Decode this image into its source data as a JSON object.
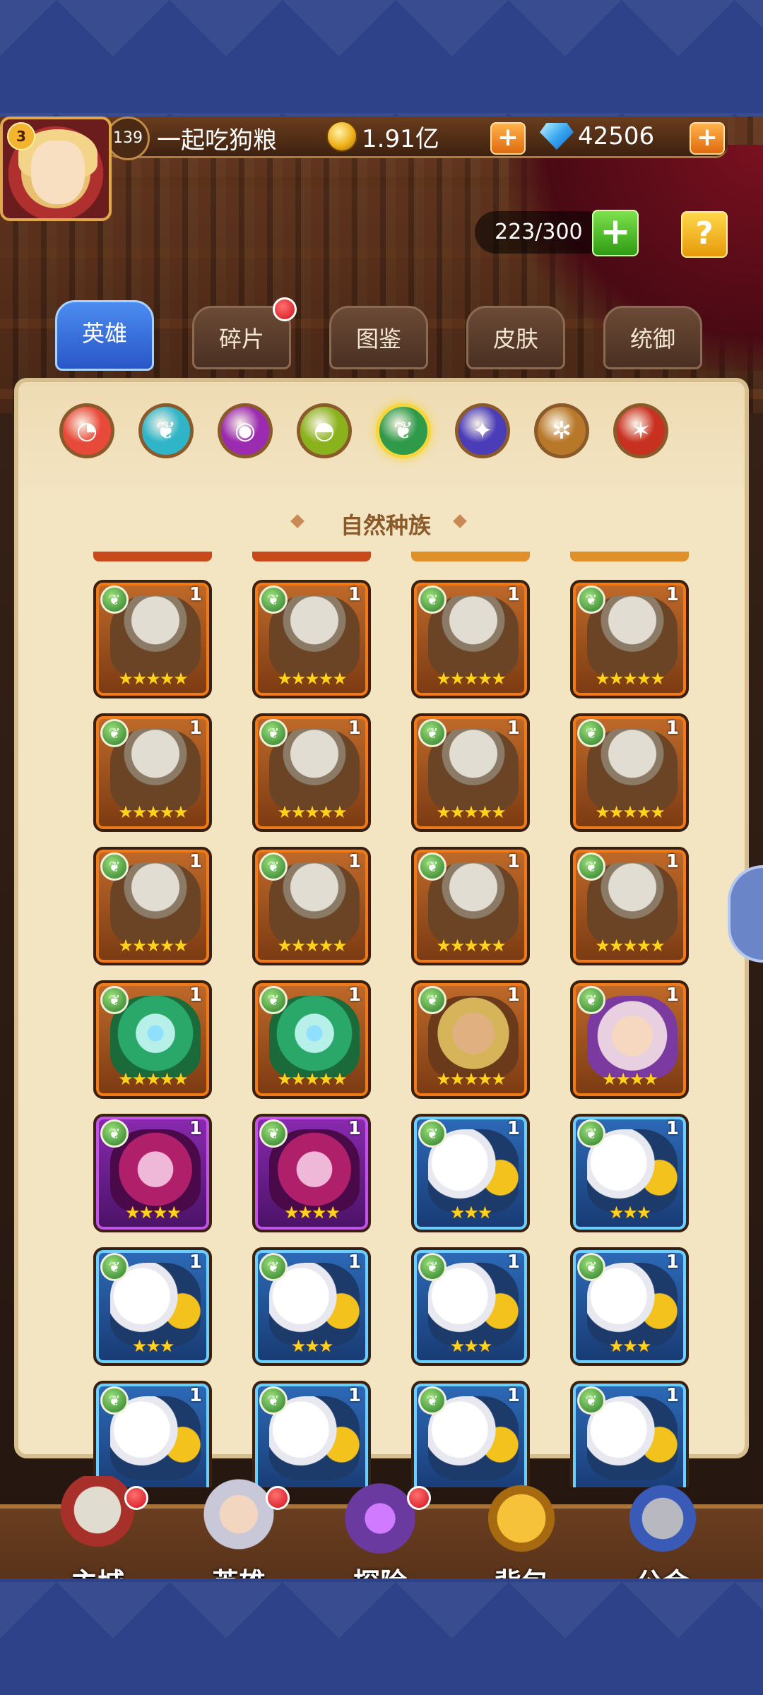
{
  "player": {
    "vip_level": "3",
    "level": "139",
    "name": "一起吃狗粮"
  },
  "resources": {
    "gold": "1.91亿",
    "diamonds": "42506"
  },
  "capacity": {
    "text": "223/300"
  },
  "tabs": [
    {
      "label": "英雄",
      "active": true,
      "badge": false
    },
    {
      "label": "碎片",
      "active": false,
      "badge": true
    },
    {
      "label": "图鉴",
      "active": false,
      "badge": false
    },
    {
      "label": "皮肤",
      "active": false,
      "badge": false
    },
    {
      "label": "统御",
      "active": false,
      "badge": false
    }
  ],
  "race_filters": [
    {
      "name": "all",
      "color": "#e84a3a",
      "selected": false
    },
    {
      "name": "water",
      "color": "#2fb4c8",
      "selected": false
    },
    {
      "name": "dark",
      "color": "#9b2bb0",
      "selected": false
    },
    {
      "name": "earth",
      "color": "#8ab21c",
      "selected": false
    },
    {
      "name": "nature",
      "color": "#2e9a4a",
      "selected": true
    },
    {
      "name": "demon",
      "color": "#4b3cb8",
      "selected": false
    },
    {
      "name": "light",
      "color": "#b8782a",
      "selected": false
    },
    {
      "name": "fire",
      "color": "#c83020",
      "selected": false
    }
  ],
  "section_title": "自然种族",
  "heroes": [
    {
      "portrait": "orc-skull",
      "frame": "orange",
      "stars": "★★★★★",
      "level": "1"
    },
    {
      "portrait": "orc-skull",
      "frame": "orange",
      "stars": "★★★★★",
      "level": "1"
    },
    {
      "portrait": "orc-skull",
      "frame": "orange",
      "stars": "★★★★★",
      "level": "1"
    },
    {
      "portrait": "orc-skull",
      "frame": "orange",
      "stars": "★★★★★",
      "level": "1"
    },
    {
      "portrait": "orc-skull",
      "frame": "orange",
      "stars": "★★★★★",
      "level": "1"
    },
    {
      "portrait": "orc-skull",
      "frame": "orange",
      "stars": "★★★★★",
      "level": "1"
    },
    {
      "portrait": "orc-skull",
      "frame": "orange",
      "stars": "★★★★★",
      "level": "1"
    },
    {
      "portrait": "orc-skull",
      "frame": "orange",
      "stars": "★★★★★",
      "level": "1"
    },
    {
      "portrait": "orc-skull",
      "frame": "orange",
      "stars": "★★★★★",
      "level": "1"
    },
    {
      "portrait": "orc-skull",
      "frame": "orange",
      "stars": "★★★★★",
      "level": "1"
    },
    {
      "portrait": "orc-skull",
      "frame": "orange",
      "stars": "★★★★★",
      "level": "1"
    },
    {
      "portrait": "orc-skull",
      "frame": "orange",
      "stars": "★★★★★",
      "level": "1"
    },
    {
      "portrait": "green-elf",
      "frame": "orange",
      "stars": "★★★★★",
      "level": "1"
    },
    {
      "portrait": "green-elf",
      "frame": "orange",
      "stars": "★★★★★",
      "level": "1"
    },
    {
      "portrait": "blond-warrior",
      "frame": "orange",
      "stars": "★★★★★",
      "level": "1"
    },
    {
      "portrait": "silver-princess",
      "frame": "orange",
      "stars": "★★★★",
      "level": "1"
    },
    {
      "portrait": "pink-sorceress",
      "frame": "purple",
      "stars": "★★★★",
      "level": "1"
    },
    {
      "portrait": "pink-sorceress",
      "frame": "purple",
      "stars": "★★★★",
      "level": "1"
    },
    {
      "portrait": "eagle",
      "frame": "blue",
      "stars": "★★★",
      "level": "1"
    },
    {
      "portrait": "eagle",
      "frame": "blue",
      "stars": "★★★",
      "level": "1"
    },
    {
      "portrait": "eagle",
      "frame": "blue",
      "stars": "★★★",
      "level": "1"
    },
    {
      "portrait": "eagle",
      "frame": "blue",
      "stars": "★★★",
      "level": "1"
    },
    {
      "portrait": "eagle",
      "frame": "blue",
      "stars": "★★★",
      "level": "1"
    },
    {
      "portrait": "eagle",
      "frame": "blue",
      "stars": "★★★",
      "level": "1"
    },
    {
      "portrait": "eagle",
      "frame": "blue",
      "stars": "",
      "level": "1"
    },
    {
      "portrait": "eagle",
      "frame": "blue",
      "stars": "",
      "level": "1"
    },
    {
      "portrait": "eagle",
      "frame": "blue",
      "stars": "",
      "level": "1"
    },
    {
      "portrait": "eagle",
      "frame": "blue",
      "stars": "",
      "level": "1"
    }
  ],
  "bottom_nav": [
    {
      "label": "主城",
      "icon": "castle-icon",
      "badge": true
    },
    {
      "label": "英雄",
      "icon": "hero-icon",
      "badge": true
    },
    {
      "label": "探险",
      "icon": "portal-icon",
      "badge": true
    },
    {
      "label": "背包",
      "icon": "backpack-icon",
      "badge": false
    },
    {
      "label": "公会",
      "icon": "guild-tower-icon",
      "badge": false
    }
  ]
}
